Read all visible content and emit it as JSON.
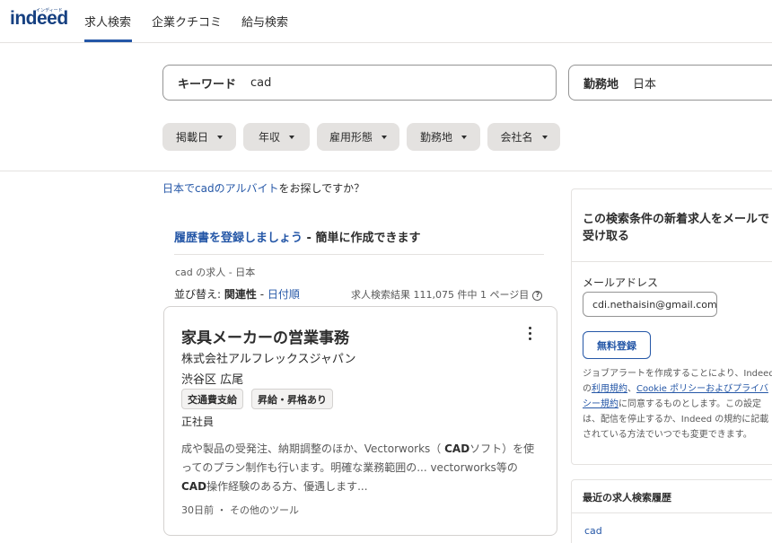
{
  "header": {
    "logo_text": "indeed",
    "logo_ruby": "インディード",
    "nav": [
      "求人検索",
      "企業クチコミ",
      "給与検索"
    ]
  },
  "search": {
    "keyword_label": "キーワード",
    "keyword_value": "cad",
    "location_label": "勤務地",
    "location_value": "日本"
  },
  "filters": [
    "掲載日",
    "年収",
    "雇用形態",
    "勤務地",
    "会社名"
  ],
  "suggestion": {
    "link": "日本でcadのアルバイト",
    "rest": "をお探しですか？"
  },
  "resume": {
    "link": "履歴書を登録しましょう",
    "rest": " - 簡単に作成できます"
  },
  "results": {
    "breadcrumb": "cad の求人 - 日本",
    "sort_prefix": "並び替え: ",
    "sort_active": "関連性",
    "sort_sep": " - ",
    "sort_link": "日付順",
    "count": "求人検索結果 111,075 件中 1 ページ目"
  },
  "job": {
    "title": "家具メーカーの営業事務",
    "company": "株式会社アルフレックスジャパン",
    "location": "渋谷区 広尾",
    "tags": [
      "交通費支給",
      "昇給・昇格あり"
    ],
    "type": "正社員",
    "snippet_1": "成や製品の受発注、納期調整のほか、Vectorworks（ ",
    "snippet_bold_1": "CAD",
    "snippet_2": "ソフト）を使ってのプラン制作も行います。明確な業務範囲の... vectorworks等の",
    "snippet_bold_2": "CAD",
    "snippet_3": "操作経験のある方、優遇します...",
    "posted": "30日前",
    "sep": " ・ ",
    "more": "その他のツール"
  },
  "alert_panel": {
    "title": "この検索条件の新着求人をメールで受け取る",
    "email_label": "メールアドレス",
    "email_value": "cdi.nethaisin@gmail.com",
    "button": "無料登録",
    "legal_1": "ジョブアラートを作成することにより、Indeed の",
    "legal_link_1": "利用規約",
    "legal_comma": "、",
    "legal_link_2": "Cookie ポリシーおよびプライバシー規約",
    "legal_2": "に同意するものとします。この設定は、配信を停止するか、Indeed の規約に記載されている方法でいつでも変更できます。"
  },
  "history_panel": {
    "title": "最近の求人検索履歴",
    "items": [
      "cad"
    ]
  },
  "colors": {
    "brand": "#164081",
    "link": "#2557a7",
    "chip_bg": "#e4e2e0"
  }
}
